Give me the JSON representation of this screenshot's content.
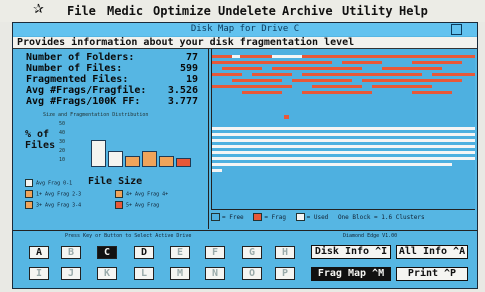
{
  "menubar": {
    "logo_icon": "atari-fuji-icon",
    "items": [
      "File",
      "Medic",
      "Optimize",
      "Undelete",
      "Archive",
      "Utility",
      "Help"
    ]
  },
  "window": {
    "title": "Disk Map for Drive C",
    "info": "Provides information about your disk fragmentation level"
  },
  "stats": [
    {
      "label": "Number of Folders:",
      "value": "77"
    },
    {
      "label": "Number of Files:",
      "value": "599"
    },
    {
      "label": "Fragmented Files:",
      "value": "19"
    },
    {
      "label": "Avg #Frags/Fragfile:",
      "value": "3.526"
    },
    {
      "label": "Avg #Frags/100K FF:",
      "value": "3.777"
    }
  ],
  "histogram": {
    "title": "Size and Fragmentation Distribution",
    "ylabel": "% of Files",
    "xlabel": "File Size",
    "yticks": [
      "50",
      "40",
      "30",
      "20",
      "10"
    ],
    "bars": [
      {
        "value": 31,
        "color": "#f4f4f0"
      },
      {
        "value": 18,
        "color": "#f4f4f0"
      },
      {
        "value": 13,
        "color": "#f0a45a"
      },
      {
        "value": 18,
        "color": "#f0a45a"
      },
      {
        "value": 12,
        "color": "#f0a45a"
      },
      {
        "value": 10,
        "color": "#e85838"
      }
    ],
    "legend": [
      {
        "label": "Avg Frag 0-1",
        "color": "#f4f4f0"
      },
      {
        "label": "1+ Avg Frag 2-3",
        "color": "#f0a45a"
      },
      {
        "label": "3+ Avg Frag 3-4",
        "color": "#f0a45a"
      },
      {
        "label": "4+ Avg Frag 4+",
        "color": "#f0a45a"
      },
      {
        "label": "5+ Avg Frag",
        "color": "#e85838"
      },
      {
        "label": "5+ Avg Frag",
        "color": "#e85838"
      }
    ]
  },
  "map_legend": {
    "free": "= Free",
    "frag": "= Frag",
    "used": "= Used",
    "block": "One Block = 1.6 Clusters",
    "colors": {
      "free": "#4eb0e0",
      "frag": "#e85838",
      "used": "#f5f5f5"
    }
  },
  "buttons": {
    "hint": "Press Key or Button to Select Active Drive",
    "version": "Diamond Edge V1.00",
    "drives_row1": [
      "A",
      "B",
      "C",
      "D",
      "E",
      "F",
      "G",
      "H"
    ],
    "drives_row2": [
      "I",
      "J",
      "K",
      "L",
      "M",
      "N",
      "O",
      "P"
    ],
    "selected_drive": "C",
    "disk_info": "Disk Info ^I",
    "all_info": "All Info ^A",
    "frag_map": "Frag Map ^M",
    "print": "Print ^P"
  }
}
